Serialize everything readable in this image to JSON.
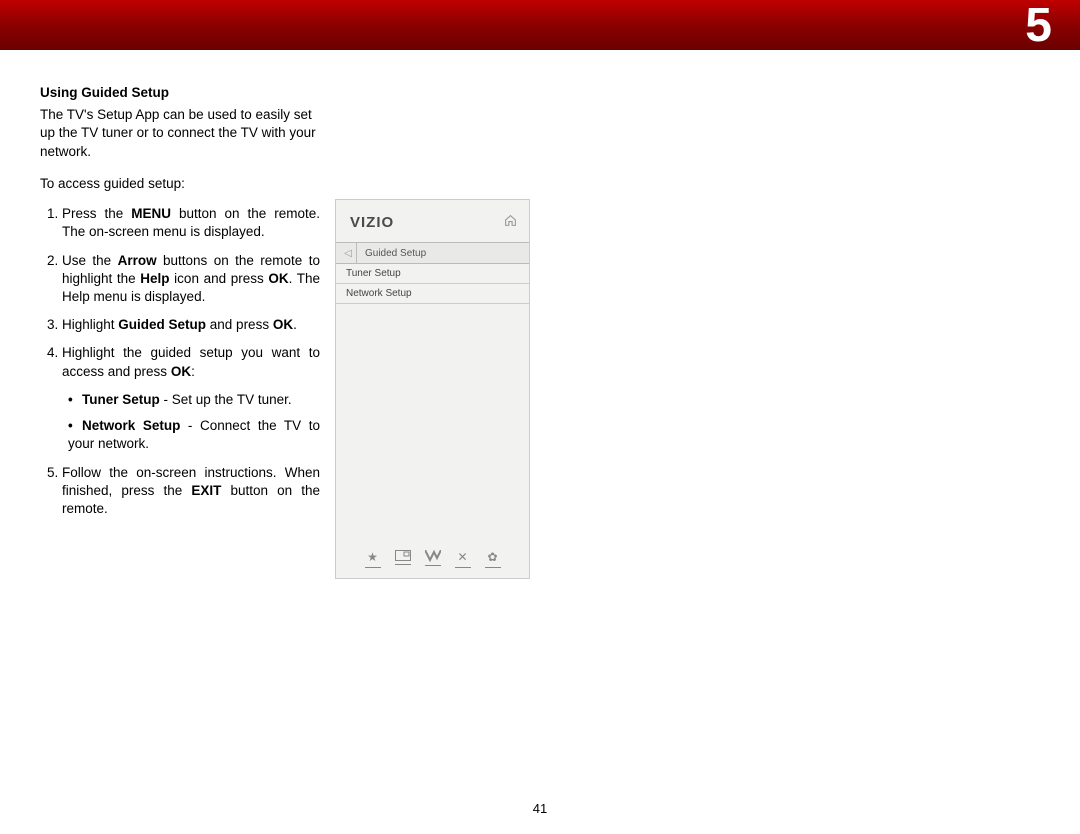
{
  "chapter_number": "5",
  "heading": "Using Guided Setup",
  "intro": "The TV's Setup App can be used to easily set up the TV tuner or to connect the TV with your network.",
  "lead": "To access guided setup:",
  "steps": {
    "s1_a": "Press the ",
    "s1_b": "MENU",
    "s1_c": " button on the remote. The on-screen menu is displayed.",
    "s2_a": "Use the ",
    "s2_b": "Arrow",
    "s2_c": " buttons on the remote to highlight the ",
    "s2_d": "Help",
    "s2_e": " icon and press ",
    "s2_f": "OK",
    "s2_g": ". The Help menu is displayed.",
    "s3_a": "Highlight ",
    "s3_b": "Guided Setup",
    "s3_c": " and press ",
    "s3_d": "OK",
    "s3_e": ".",
    "s4_a": "Highlight the guided setup you want to access and press ",
    "s4_b": "OK",
    "s4_c": ":",
    "b1_a": "Tuner Setup",
    "b1_b": " - Set up the TV tuner.",
    "b2_a": "Network Setup",
    "b2_b": " - Connect the TV to your network.",
    "s5_a": "Follow the on-screen instructions. When finished, press the ",
    "s5_b": "EXIT",
    "s5_c": " button on the remote."
  },
  "screenshot": {
    "logo": "VIZIO",
    "breadcrumb": "Guided Setup",
    "rows": [
      "Tuner Setup",
      "Network Setup"
    ]
  },
  "page_number": "41"
}
